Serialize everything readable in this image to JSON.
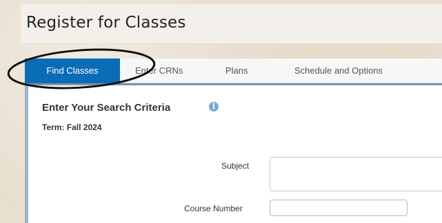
{
  "header": {
    "title": "Register for Classes"
  },
  "tabs": [
    {
      "label": "Find Classes",
      "active": true
    },
    {
      "label": "Enter CRNs",
      "active": false
    },
    {
      "label": "Plans",
      "active": false
    },
    {
      "label": "Schedule and Options",
      "active": false
    }
  ],
  "search": {
    "heading": "Enter Your Search Criteria",
    "info_icon": "info-icon",
    "term": "Term: Fall 2024",
    "subject_label": "Subject",
    "subject_value": "",
    "course_number_label": "Course Number",
    "course_number_value": ""
  },
  "colors": {
    "accent": "#0b6cb6",
    "panel_border": "#9fb3c8",
    "background": "#e9dfd0"
  }
}
